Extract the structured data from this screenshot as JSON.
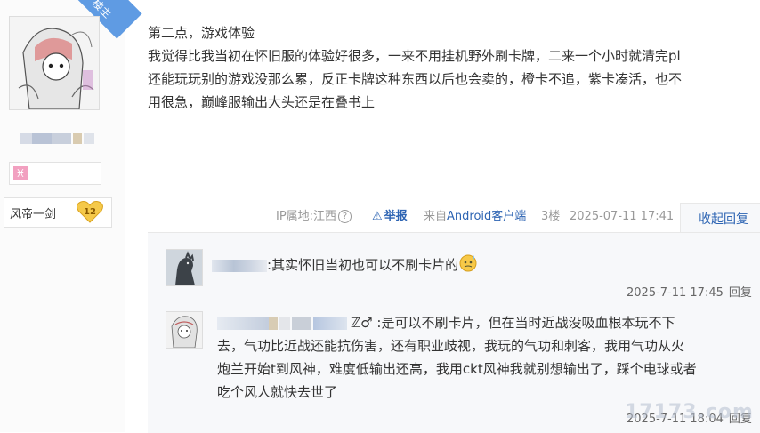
{
  "user": {
    "badge": "楼主",
    "zodiac_icon": "pisces-icon",
    "fan_group_name": "风帝一剑",
    "fan_level": "12"
  },
  "post": {
    "lines": [
      "第二点，游戏体验",
      "我觉得比我当初在怀旧服的体验好很多，一来不用挂机野外刷卡牌，二来一个小时就清完pl",
      "还能玩玩别的游戏没那么累，反正卡牌这种东西以后也会卖的，橙卡不追，紫卡凑活，也不",
      "用很急，巅峰服输出大头还是在叠书上"
    ]
  },
  "meta": {
    "ip": "IP属地:江西",
    "help_icon": "?",
    "report_icon": "⚠",
    "report": "举报",
    "client_prefix": "来自",
    "client": "Android客户端",
    "floor": "3楼",
    "time": "2025-07-11 17:41",
    "collapse": "收起回复"
  },
  "replies": [
    {
      "name_suffix": ":",
      "lines": [
        "其实怀旧当初也可以不刷卡片的"
      ],
      "time": "2025-7-11 17:45",
      "reply_label": "回复"
    },
    {
      "name_suffix": "ℤ♂ :",
      "lines": [
        "是可以不刷卡片，但在当时近战没吸血根本玩不下",
        "去，气功比近战还能抗伤害，还有职业歧视，我玩的气功和刺客，我用气功从火",
        "炮兰开始t到风神，难度低输出还高，我用ckt风神我就别想输出了，踩个电球或者",
        "吃个风人就快去世了"
      ],
      "time": "2025-7-11 18:04",
      "reply_label": "回复"
    }
  ],
  "watermark": "17173.com",
  "colors": {
    "link": "#2d64b3",
    "ribbon": "#5f9be3",
    "muted": "#999999",
    "reply_bg": "#f7f8fa"
  }
}
